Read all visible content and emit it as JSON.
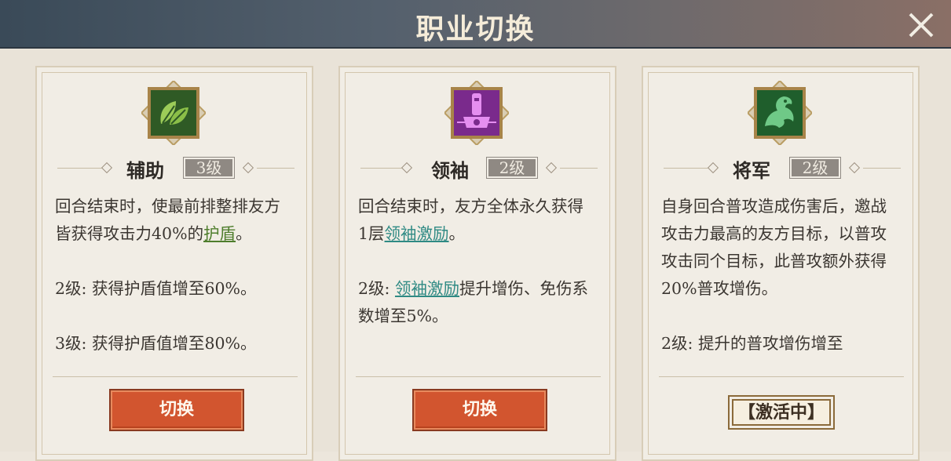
{
  "header": {
    "title": "职业切换"
  },
  "cards": [
    {
      "name": "辅助",
      "level": "3级",
      "icon": "leaf-icon",
      "desc": {
        "p1_a": "回合结束时，使最前排整排友方皆获得攻击力40%的",
        "p1_link": "护盾",
        "p1_b": "。",
        "p2": "2级: 获得护盾值增至60%。",
        "p3": "3级: 获得护盾值增至80%。"
      },
      "button": "切换"
    },
    {
      "name": "领袖",
      "level": "2级",
      "icon": "banner-icon",
      "desc": {
        "p1_a": "回合结束时，友方全体永久获得1层",
        "p1_link": "领袖激励",
        "p1_b": "。",
        "p2_pre": "2级: ",
        "p2_link": "领袖激励",
        "p2_b": "提升增伤、免伤系数增至5%。"
      },
      "button": "切换"
    },
    {
      "name": "将军",
      "level": "2级",
      "icon": "dragon-icon",
      "desc": {
        "p1": "自身回合普攻造成伤害后，邀战攻击力最高的友方目标，以普攻攻击同个目标，此普攻额外获得20%普攻增伤。",
        "p2": "2级: 提升的普攻增伤增至"
      },
      "status": "【激活中】"
    }
  ],
  "colors": {
    "support": "#2f5a25",
    "leader": "#7a2a8c",
    "general": "#1f5e2c",
    "button": "#d2552f"
  }
}
